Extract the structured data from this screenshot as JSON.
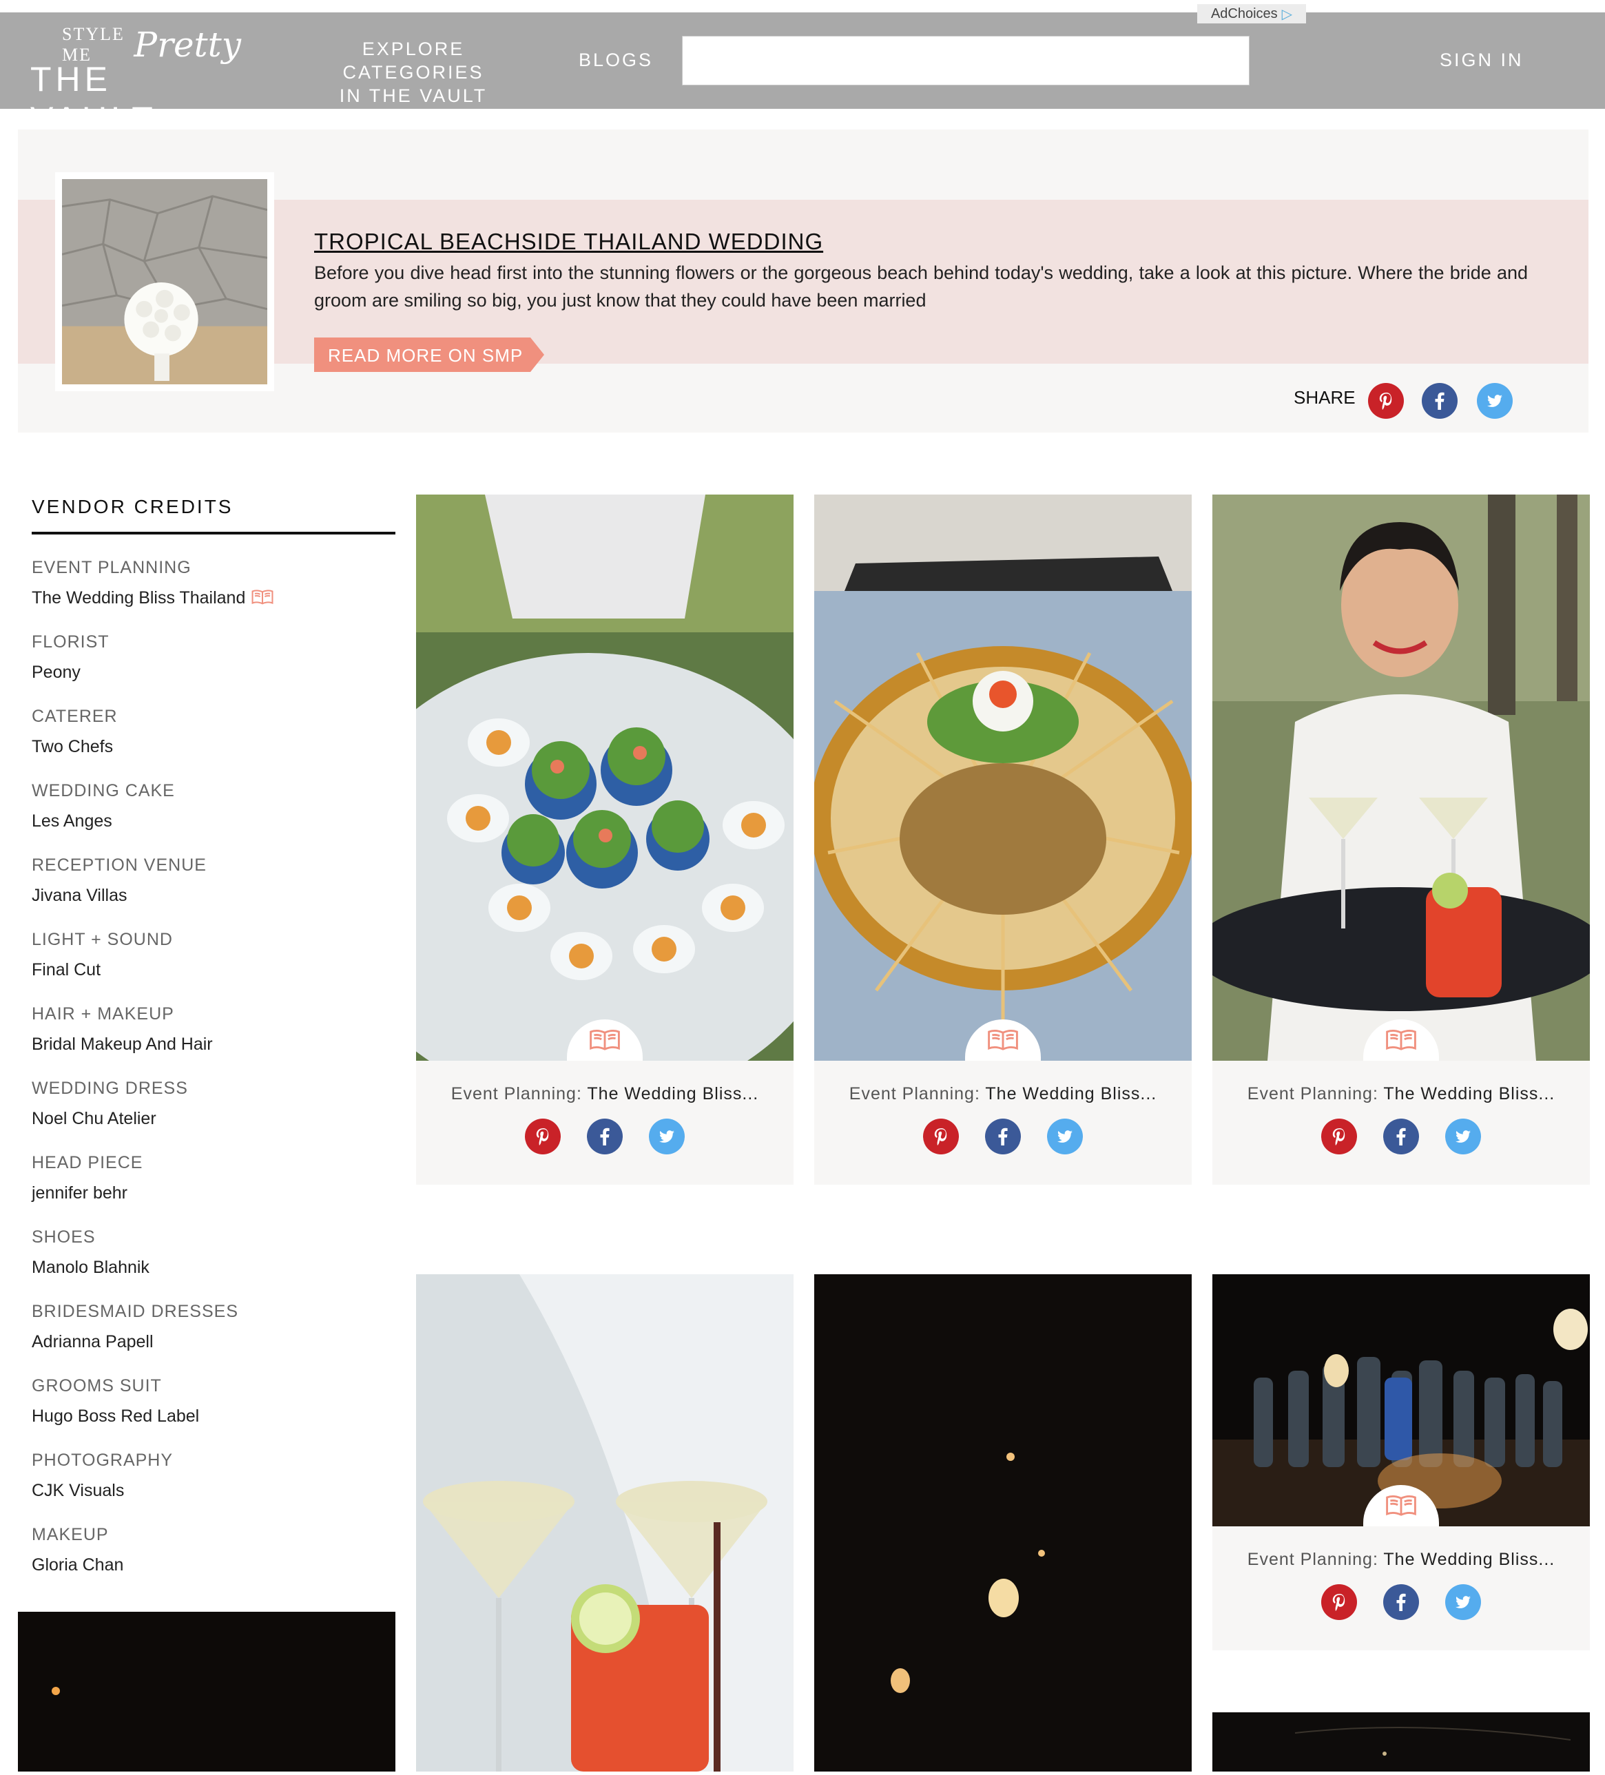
{
  "header": {
    "ad_label": "AdChoices",
    "logo_small": "STYLE ME",
    "logo_script": "Pretty",
    "logo_main": "THE VAULT",
    "nav_explore_line1": "EXPLORE CATEGORIES",
    "nav_explore_line2": "IN THE VAULT",
    "nav_blogs": "BLOGS",
    "search_value": "",
    "sign_in": "SIGN IN"
  },
  "feature": {
    "title": "TROPICAL BEACHSIDE THAILAND WEDDING",
    "description": "Before you dive head first into the stunning flowers or the gorgeous beach behind today's wedding, take a look at this picture. Where the bride and groom are smiling so big, you just know that they could have been married",
    "read_more": "READ MORE ON SMP",
    "share_label": "SHARE"
  },
  "vendor_credits": {
    "title": "VENDOR CREDITS",
    "items": [
      {
        "role": "EVENT PLANNING",
        "name": "The Wedding Bliss Thailand"
      },
      {
        "role": "FLORIST",
        "name": "Peony"
      },
      {
        "role": "CATERER",
        "name": "Two Chefs"
      },
      {
        "role": "WEDDING CAKE",
        "name": "Les Anges"
      },
      {
        "role": "RECEPTION VENUE",
        "name": "Jivana Villas"
      },
      {
        "role": "LIGHT + SOUND",
        "name": "Final Cut"
      },
      {
        "role": "HAIR + MAKEUP",
        "name": "Bridal Makeup And Hair"
      },
      {
        "role": "WEDDING DRESS",
        "name": "Noel Chu Atelier"
      },
      {
        "role": "HEAD PIECE",
        "name": "jennifer behr"
      },
      {
        "role": "SHOES",
        "name": "Manolo Blahnik"
      },
      {
        "role": "BRIDESMAID DRESSES",
        "name": "Adrianna Papell"
      },
      {
        "role": "GROOMS SUIT",
        "name": "Hugo Boss Red Label"
      },
      {
        "role": "PHOTOGRAPHY",
        "name": "CJK Visuals"
      },
      {
        "role": "MAKEUP",
        "name": "Gloria Chan"
      }
    ]
  },
  "cards": [
    {
      "label": "Event Planning:",
      "value": "The Wedding Bliss..."
    },
    {
      "label": "Event Planning:",
      "value": "The Wedding Bliss..."
    },
    {
      "label": "Event Planning:",
      "value": "The Wedding Bliss..."
    },
    {
      "label": "Event Planning:",
      "value": "The Wedding Bliss..."
    }
  ],
  "colors": {
    "header_bg": "#a9a9a9",
    "accent_salmon": "#f0907e",
    "pinterest": "#c92228",
    "facebook": "#3b5998",
    "twitter": "#55acee"
  }
}
